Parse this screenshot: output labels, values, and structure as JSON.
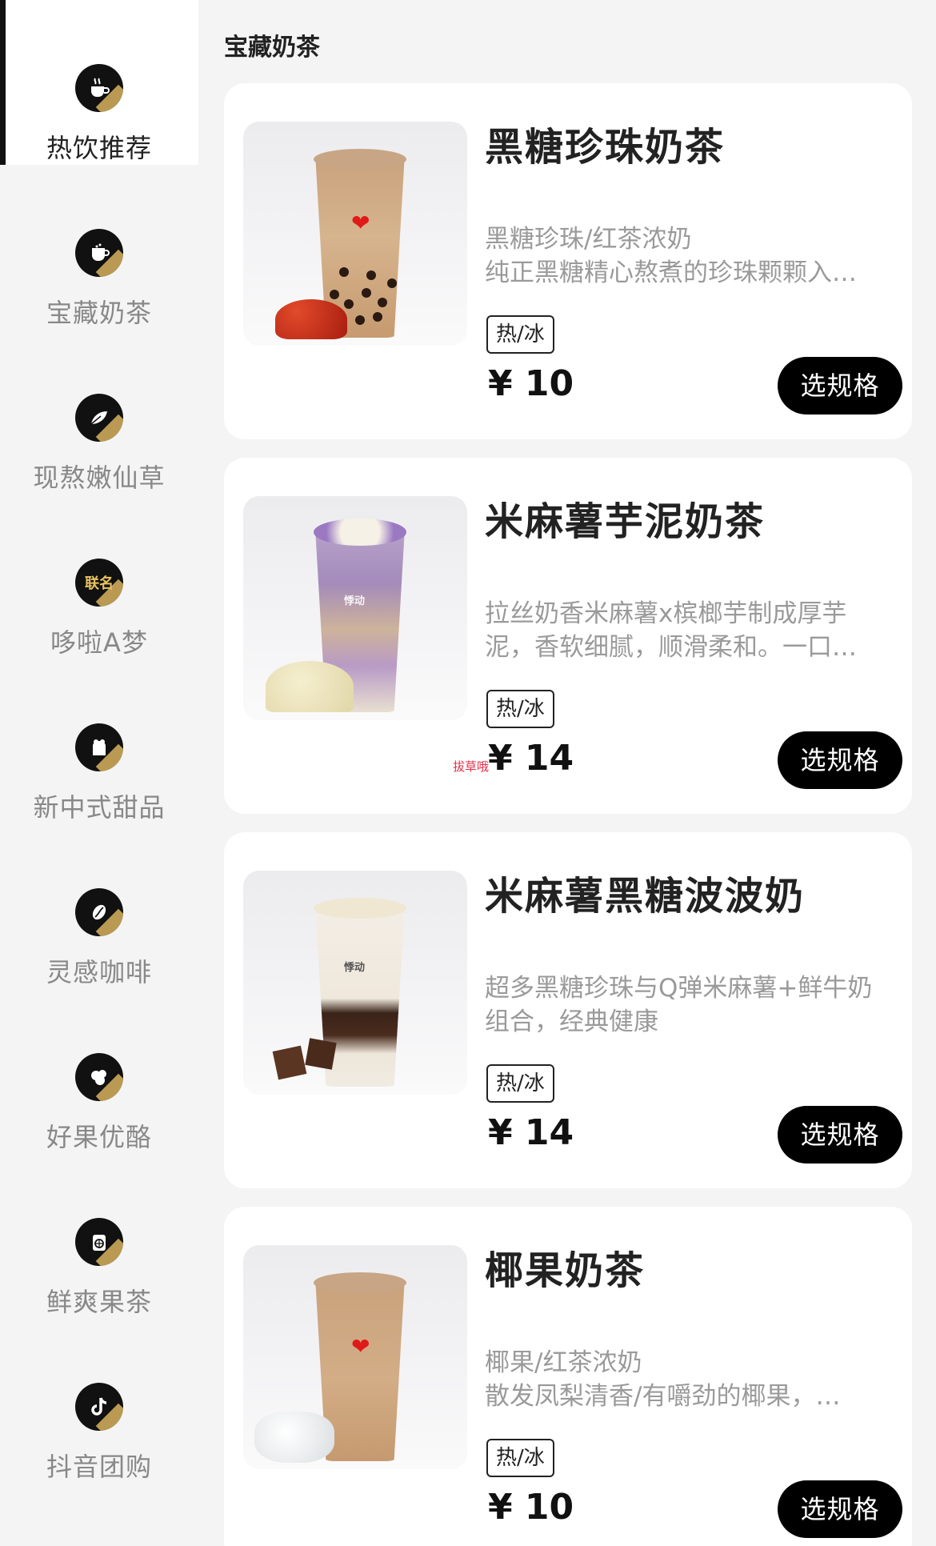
{
  "sidebar": {
    "items": [
      {
        "label": "热饮推荐",
        "icon": "hot-drink-icon",
        "active": true
      },
      {
        "label": "宝藏奶茶",
        "icon": "milk-tea-cup-icon",
        "active": false
      },
      {
        "label": "现熬嫩仙草",
        "icon": "grass-jelly-leaf-icon",
        "active": false
      },
      {
        "label": "哆啦A梦",
        "icon": "collab-badge-icon",
        "badge": "联名",
        "active": false
      },
      {
        "label": "新中式甜品",
        "icon": "dessert-icon",
        "active": false
      },
      {
        "label": "灵感咖啡",
        "icon": "coffee-bean-icon",
        "active": false
      },
      {
        "label": "好果优酪",
        "icon": "fruit-yogurt-icon",
        "active": false
      },
      {
        "label": "鲜爽果茶",
        "icon": "fruit-tea-icon",
        "active": false
      },
      {
        "label": "抖音团购",
        "icon": "douyin-icon",
        "active": false
      }
    ]
  },
  "main": {
    "section_title": "宝藏奶茶",
    "products": [
      {
        "name": "黑糖珍珠奶茶",
        "desc_line1": "黑糖珍珠/红茶浓奶",
        "desc_line2": "纯正黑糖精心熬煮的珍珠颗颗入…",
        "tag": "热/冰",
        "price": "¥ 10",
        "button": "选规格"
      },
      {
        "name": "米麻薯芋泥奶茶",
        "desc_line1": "拉丝奶香米麻薯x槟榔芋制成厚芋",
        "desc_line2": "泥，香软细腻，顺滑柔和。一口…",
        "tag": "热/冰",
        "price": "¥ 14",
        "button": "选规格",
        "watermark": "拔草哦"
      },
      {
        "name": "米麻薯黑糖波波奶",
        "desc_line1": "超多黑糖珍珠与Q弹米麻薯+鲜牛奶",
        "desc_line2": "组合，经典健康",
        "tag": "热/冰",
        "price": "¥ 14",
        "button": "选规格"
      },
      {
        "name": "椰果奶茶",
        "desc_line1": "椰果/红茶浓奶",
        "desc_line2": "散发凤梨清香/有嚼劲的椰果，…",
        "tag": "热/冰",
        "price": "¥ 10",
        "button": "选规格"
      }
    ]
  },
  "colors": {
    "accent": "#000000",
    "icon_gold": "#d8b35f",
    "page_bg": "#f4f4f4",
    "card_bg": "#ffffff",
    "muted_text": "#9a9a9a",
    "heart_red": "#e01919"
  }
}
